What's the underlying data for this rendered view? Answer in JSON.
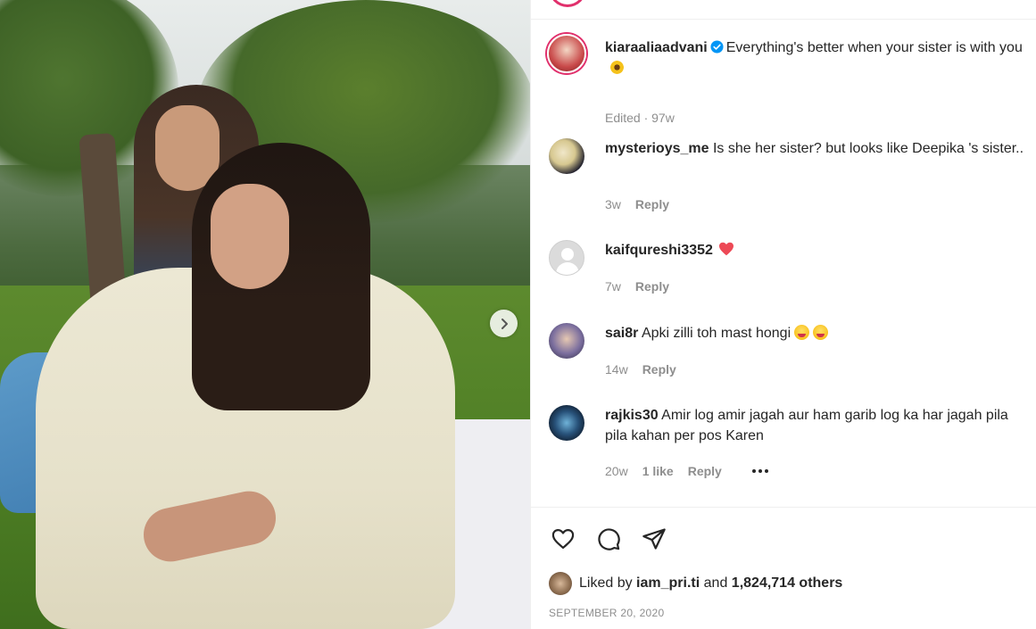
{
  "post": {
    "author": "kiaraaliaadvani",
    "caption": "Everything's better when your sister is with you",
    "caption_emoji": "sunflower",
    "meta": "Edited · 97w"
  },
  "comments": [
    {
      "user": "mysterioys_me",
      "text": "Is she her sister? but looks like Deepika 's sister..",
      "age": "3w",
      "reply": "Reply"
    },
    {
      "user": "kaifqureshi3352",
      "text": "",
      "emoji": "red-heart",
      "age": "7w",
      "reply": "Reply"
    },
    {
      "user": "sai8r",
      "text": "Apki zilli toh mast hongi",
      "emoji": "laughing-face x2",
      "age": "14w",
      "reply": "Reply"
    },
    {
      "user": "rajkis30",
      "text": "Amir log amir jagah aur ham garib log ka har jagah pila pila kahan per pos Karen",
      "age": "20w",
      "likes": "1 like",
      "reply": "Reply"
    }
  ],
  "likes": {
    "prefix": "Liked by",
    "user": "iam_pri.ti",
    "middle": "and",
    "count": "1,824,714 others"
  },
  "date": "SEPTEMBER 20, 2020",
  "colors": {
    "accent": "#0095f6",
    "heart": "#ed4956",
    "text": "#262626",
    "muted": "#8e8e8e"
  }
}
